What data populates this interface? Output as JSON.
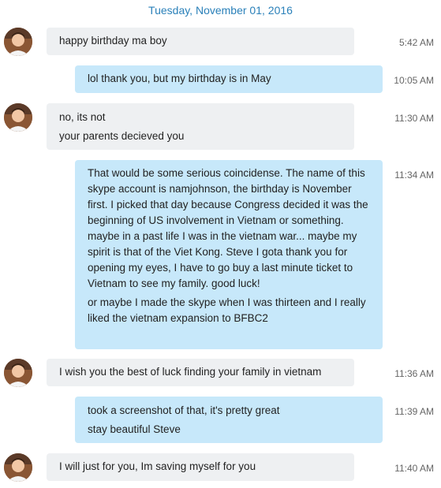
{
  "date_header": "Tuesday, November 01, 2016",
  "messages": [
    {
      "direction": "in",
      "time": "5:42 AM",
      "lines": [
        "happy birthday ma boy"
      ]
    },
    {
      "direction": "out",
      "time": "10:05 AM",
      "lines": [
        "lol thank you, but my birthday is in May"
      ]
    },
    {
      "direction": "in",
      "time": "11:30 AM",
      "lines": [
        "no, its not",
        "your parents decieved you"
      ]
    },
    {
      "direction": "out",
      "time": "11:34 AM",
      "lines": [
        "That would be some serious coincidense. The name of this skype account is namjohnson, the birthday is November first. I picked that day because Congress decided it was the beginning of US involvement in Vietnam or something. maybe in a past life I was in the vietnam war... maybe my spirit is that of the Viet Kong. Steve I gota thank you for opening my eyes, I have to go buy a last minute ticket to Vietnam to see my family. good luck!",
        "or maybe I made the skype when I was thirteen and I really liked the vietnam expansion to BFBC2"
      ]
    },
    {
      "direction": "in",
      "time": "11:36 AM",
      "lines": [
        "I wish you the best of luck finding your family in vietnam"
      ]
    },
    {
      "direction": "out",
      "time": "11:39 AM",
      "lines": [
        "took a screenshot of that, it's pretty great",
        "stay beautiful Steve"
      ]
    },
    {
      "direction": "in",
      "time": "11:40 AM",
      "lines": [
        "I will just for you, Im saving myself for you"
      ]
    }
  ]
}
